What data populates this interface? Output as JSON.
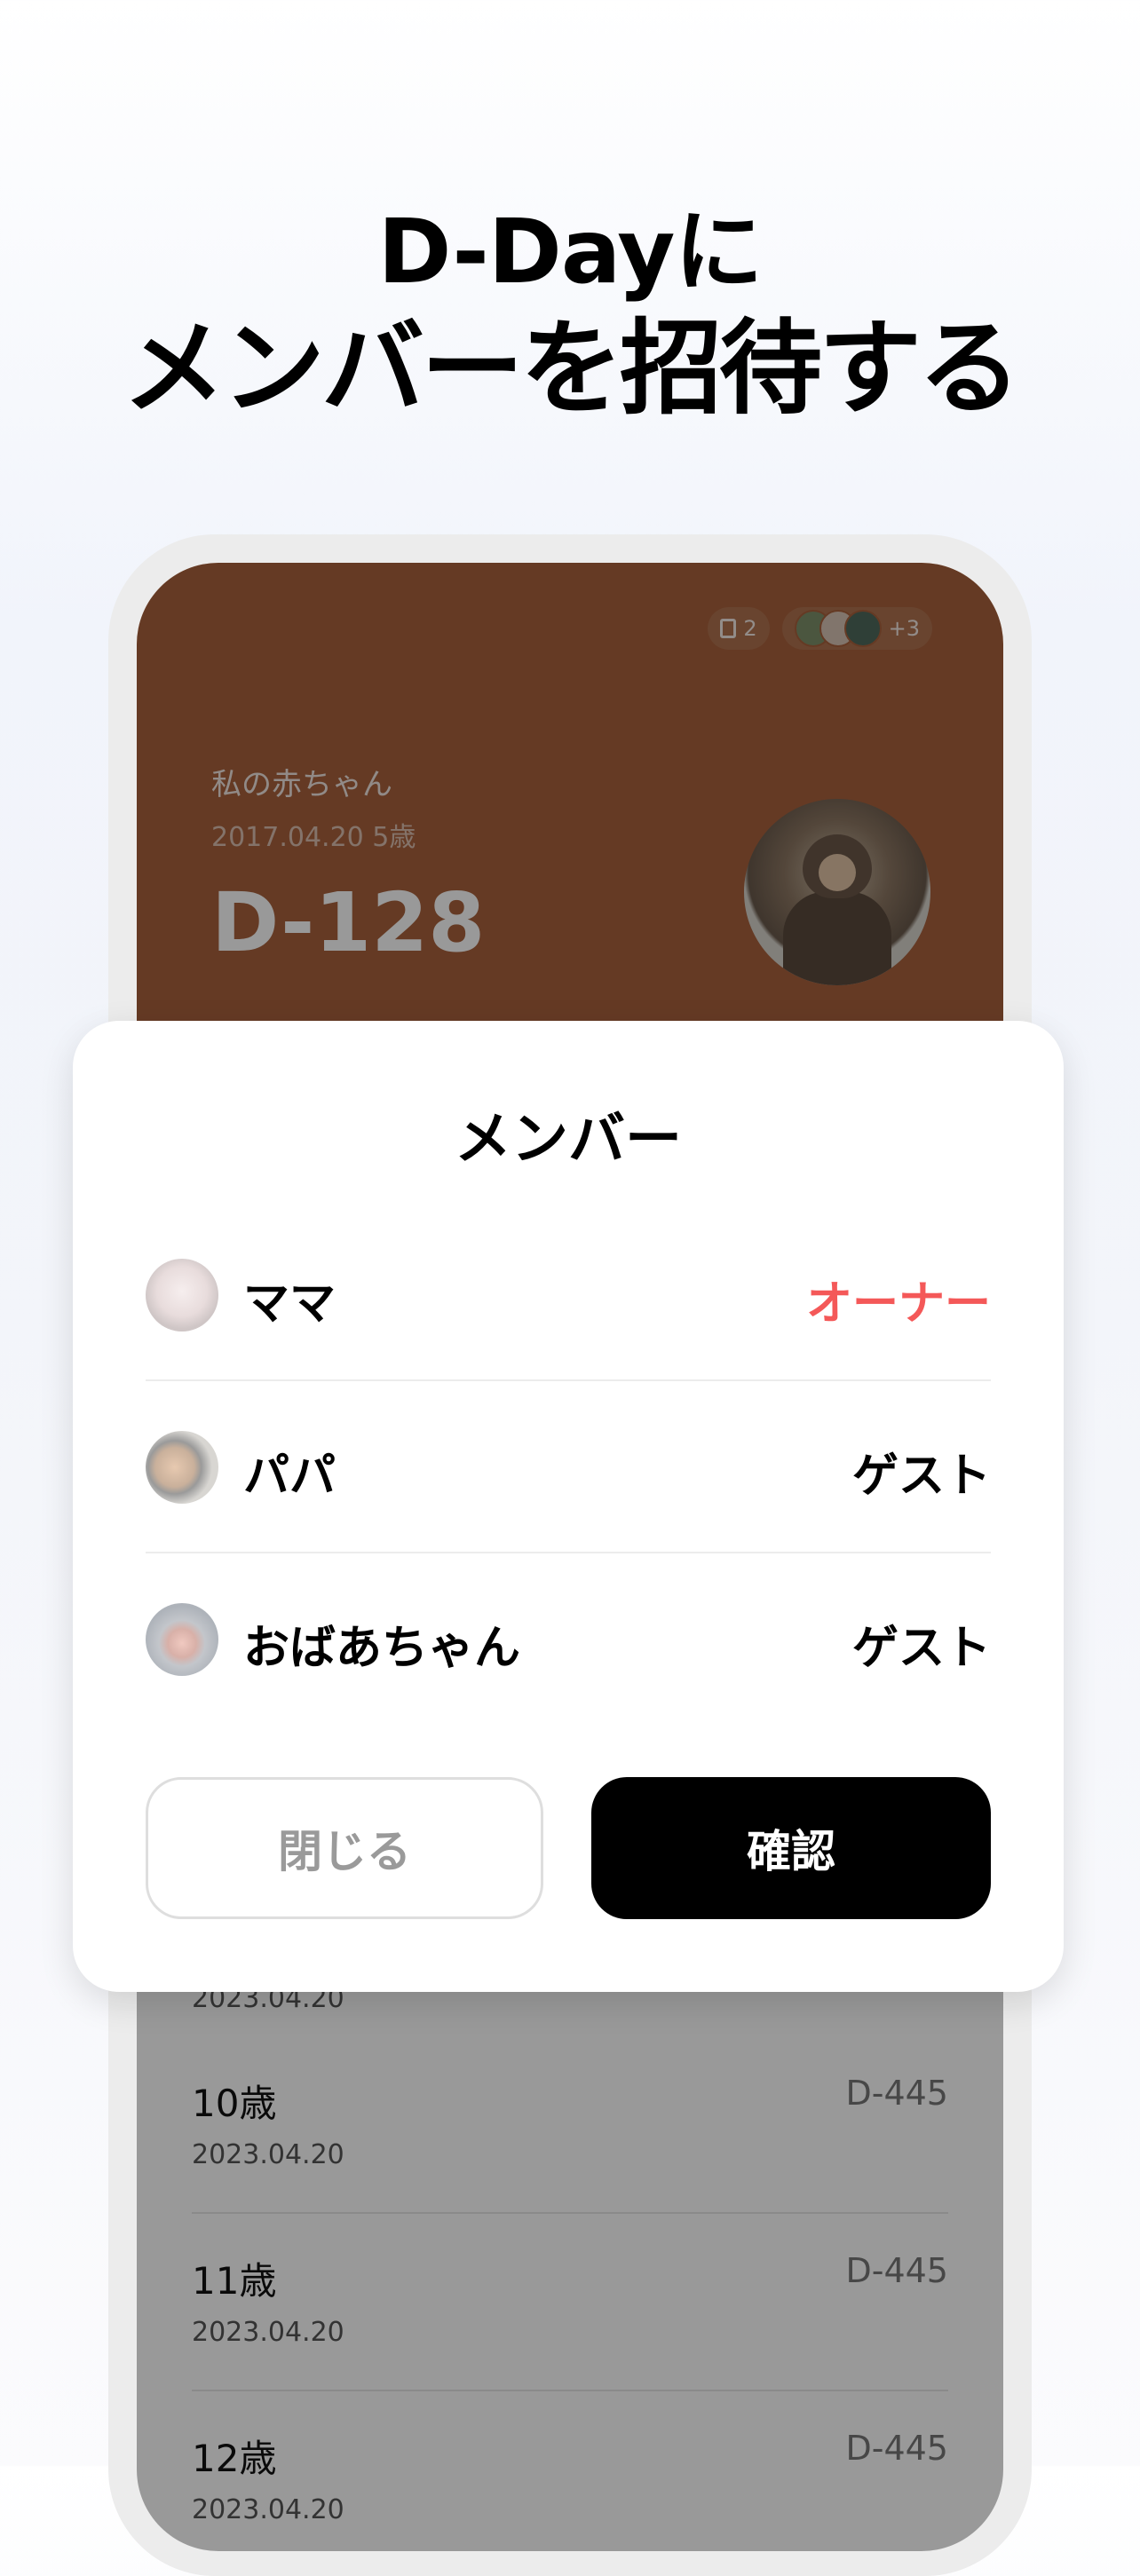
{
  "headline": {
    "line1": "D-Dayに",
    "line2": "メンバーを招待する"
  },
  "dday_card": {
    "doc_count": "2",
    "members_extra": "+3",
    "child_name": "私の赤ちゃん",
    "birth_info": "2017.04.20 5歳",
    "dday": "D-128"
  },
  "milestones": {
    "partial_date": "2023.04.20",
    "items": [
      {
        "age": "10歳",
        "date": "2023.04.20",
        "dday": "D-445"
      },
      {
        "age": "11歳",
        "date": "2023.04.20",
        "dday": "D-445"
      },
      {
        "age": "12歳",
        "date": "2023.04.20",
        "dday": "D-445"
      }
    ]
  },
  "modal": {
    "title": "メンバー",
    "members": [
      {
        "name": "ママ",
        "role": "オーナー"
      },
      {
        "name": "パパ",
        "role": "ゲスト"
      },
      {
        "name": "おばあちゃん",
        "role": "ゲスト"
      }
    ],
    "close_label": "閉じる",
    "confirm_label": "確認"
  },
  "colors": {
    "owner_role": "#f45858",
    "card_brown": "#a8623c",
    "confirm_button": "#000000"
  }
}
